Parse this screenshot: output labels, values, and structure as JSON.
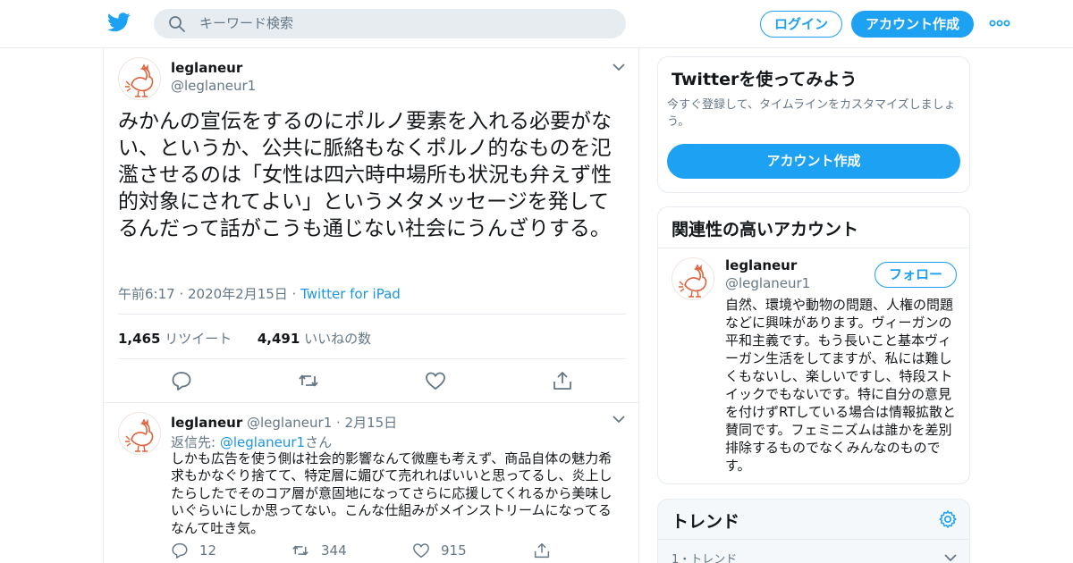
{
  "header": {
    "search_placeholder": "キーワード検索",
    "login_label": "ログイン",
    "signup_label": "アカウント作成"
  },
  "tweet": {
    "name": "leglaneur",
    "handle": "@leglaneur1",
    "text": "みかんの宣伝をするのにポルノ要素を入れる必要がない、というか、公共に脈絡もなくポルノ的なものを氾濫させるのは「女性は四六時中場所も状況も弁えず性的対象にされてよい」というメタメッセージを発してるんだって話がこうも通じない社会にうんざりする。",
    "timestamp": "午前6:17 · 2020年2月15日 · ",
    "source": "Twitter for iPad",
    "retweet_count": "1,465",
    "retweet_label": " リツイート",
    "like_count": "4,491",
    "like_label": " いいねの数"
  },
  "reply": {
    "name": "leglaneur",
    "handle": " @leglaneur1 · 2月15日",
    "reply_to_prefix": "返信先: ",
    "reply_to_handle": "@leglaneur1",
    "reply_to_suffix": "さん",
    "text": "しかも広告を使う側は社会的影響なんて微塵も考えず、商品自体の魅力希求もかなぐり捨てて、特定層に媚びて売れればいいと思ってるし、炎上したらしたでそのコア層が意固地になってさらに応援してくれるから美味しいぐらいにしか思ってない。こんな仕組みがメインストリームになってるなんて吐き気。",
    "reply_count": "12",
    "retweet_count": "344",
    "like_count": "915"
  },
  "sidebar": {
    "signup_card": {
      "title": "Twitterを使ってみよう",
      "subtitle": "今すぐ登録して、タイムラインをカスタマイズしましょう。",
      "button": "アカウント作成"
    },
    "related": {
      "title": "関連性の高いアカウント",
      "name": "leglaneur",
      "handle": "@leglaneur1",
      "follow_label": "フォロー",
      "bio": "自然、環境や動物の問題、人権の問題などに興味があります。ヴィーガンの平和主義です。もう長いこと基本ヴィーガン生活をしてますが、私には難しくもないし、楽しいですし、特段ストイックでもないです。特に自分の意見を付けずRTしている場合は情報拡散と賛同です。フェミニズムは誰かを差別排除するものでなくみんなのものです。"
    },
    "trends": {
      "title": "トレンド",
      "first_item": "1・トレンド"
    }
  },
  "colors": {
    "brand": "#1da1f2",
    "link": "#1b95e0",
    "muted": "#657786",
    "border": "#e6ecf0",
    "avatar_art": "#e0603a"
  },
  "icons": [
    "twitter-bird-icon",
    "search-icon",
    "more-icon",
    "chevron-down-icon",
    "reply-icon",
    "retweet-icon",
    "like-icon",
    "share-icon",
    "gear-icon"
  ]
}
